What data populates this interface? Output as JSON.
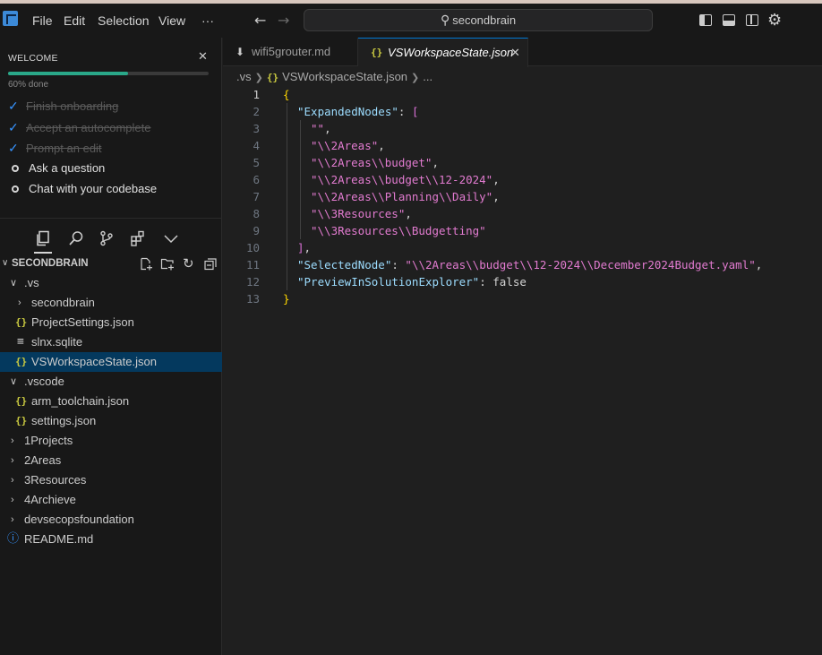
{
  "menu": {
    "items": [
      "File",
      "Edit",
      "Selection",
      "View"
    ],
    "more": "···"
  },
  "search": {
    "text": "secondbrain"
  },
  "welcome": {
    "title": "WELCOME",
    "progress_fraction": 0.6,
    "progress_text": "60% done",
    "steps": [
      {
        "label": "Finish onboarding",
        "done": true
      },
      {
        "label": "Accept an autocomplete",
        "done": true
      },
      {
        "label": "Prompt an edit",
        "done": true
      },
      {
        "label": "Ask a question",
        "done": false
      },
      {
        "label": "Chat with your codebase",
        "done": false
      }
    ]
  },
  "explorer": {
    "title": "SECONDBRAIN",
    "rows": [
      {
        "label": ".vs",
        "kind": "folder-open"
      },
      {
        "label": "secondbrain",
        "kind": "folder-closed"
      },
      {
        "label": "ProjectSettings.json",
        "kind": "json"
      },
      {
        "label": "slnx.sqlite",
        "kind": "db"
      },
      {
        "label": "VSWorkspaceState.json",
        "kind": "json",
        "selected": true
      },
      {
        "label": ".vscode",
        "kind": "folder-open"
      },
      {
        "label": "arm_toolchain.json",
        "kind": "json"
      },
      {
        "label": "settings.json",
        "kind": "json"
      },
      {
        "label": "1Projects",
        "kind": "folder-closed"
      },
      {
        "label": "2Areas",
        "kind": "folder-closed"
      },
      {
        "label": "3Resources",
        "kind": "folder-closed"
      },
      {
        "label": "4Archieve",
        "kind": "folder-closed"
      },
      {
        "label": "devsecopsfoundation",
        "kind": "folder-closed"
      },
      {
        "label": "README.md",
        "kind": "info"
      }
    ]
  },
  "tabs": [
    {
      "label": "wifi5grouter.md",
      "active": false
    },
    {
      "label": "VSWorkspaceState.json",
      "active": true
    }
  ],
  "breadcrumb": {
    "folder": ".vs",
    "file": "VSWorkspaceState.json",
    "rest": "..."
  },
  "code": {
    "line_numbers": [
      "1",
      "2",
      "3",
      "4",
      "5",
      "6",
      "7",
      "8",
      "9",
      "10",
      "11",
      "12",
      "13"
    ],
    "expanded_key": "\"ExpandedNodes\"",
    "expanded_values": [
      "\"\"",
      "\"\\\\2Areas\"",
      "\"\\\\2Areas\\\\budget\"",
      "\"\\\\2Areas\\\\budget\\\\12-2024\"",
      "\"\\\\2Areas\\\\Planning\\\\Daily\"",
      "\"\\\\3Resources\"",
      "\"\\\\3Resources\\\\Budgetting\""
    ],
    "selected_key": "\"SelectedNode\"",
    "selected_value": "\"\\\\2Areas\\\\budget\\\\12-2024\\\\December2024Budget.yaml\"",
    "preview_key": "\"PreviewInSolutionExplorer\"",
    "preview_value": "false"
  },
  "colors": {
    "accent": "#0078d4",
    "progress": "#2aa889",
    "selection": "#04395e",
    "json_key": "#9cdcfe",
    "json_string": "#ce9178"
  }
}
